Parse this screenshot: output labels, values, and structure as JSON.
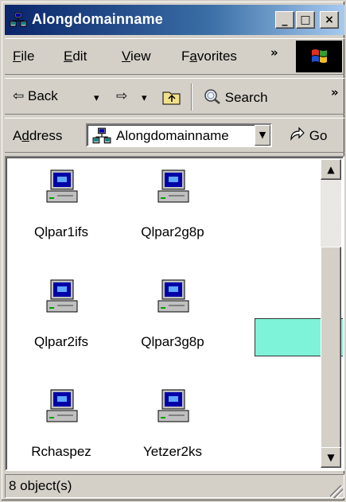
{
  "window": {
    "title": "Alongdomainname",
    "min_glyph": "_",
    "max_glyph": "□",
    "close_glyph": "×"
  },
  "menubar": {
    "items": [
      {
        "acc": "F",
        "rest": "ile"
      },
      {
        "acc": "E",
        "rest": "dit"
      },
      {
        "acc": "V",
        "rest": "iew"
      },
      {
        "pre": "F",
        "acc": "a",
        "rest": "vorites"
      }
    ],
    "overflow": "»"
  },
  "toolbar": {
    "back_label": "Back",
    "back_glyph": "⇦",
    "forward_glyph": "⇨",
    "dropdown_glyph": "▾",
    "search_label": "Search",
    "overflow": "»"
  },
  "address": {
    "label_pre": "A",
    "label_acc": "d",
    "label_rest": "dress",
    "value": "Alongdomainname",
    "go_label": "Go"
  },
  "items": [
    {
      "label": "Qlpar1ifs"
    },
    {
      "label": "Qlpar2g8p"
    },
    {
      "label": "Qlpar2ifs"
    },
    {
      "label": "Qlpar3g8p"
    },
    {
      "label": "Rchaspez"
    },
    {
      "label": "Yetzer2ks"
    }
  ],
  "status": {
    "text": "8 object(s)"
  },
  "colors": {
    "titlebar_start": "#0a246a",
    "titlebar_end": "#a6caf0",
    "highlight_box": "#7ff3d9"
  }
}
